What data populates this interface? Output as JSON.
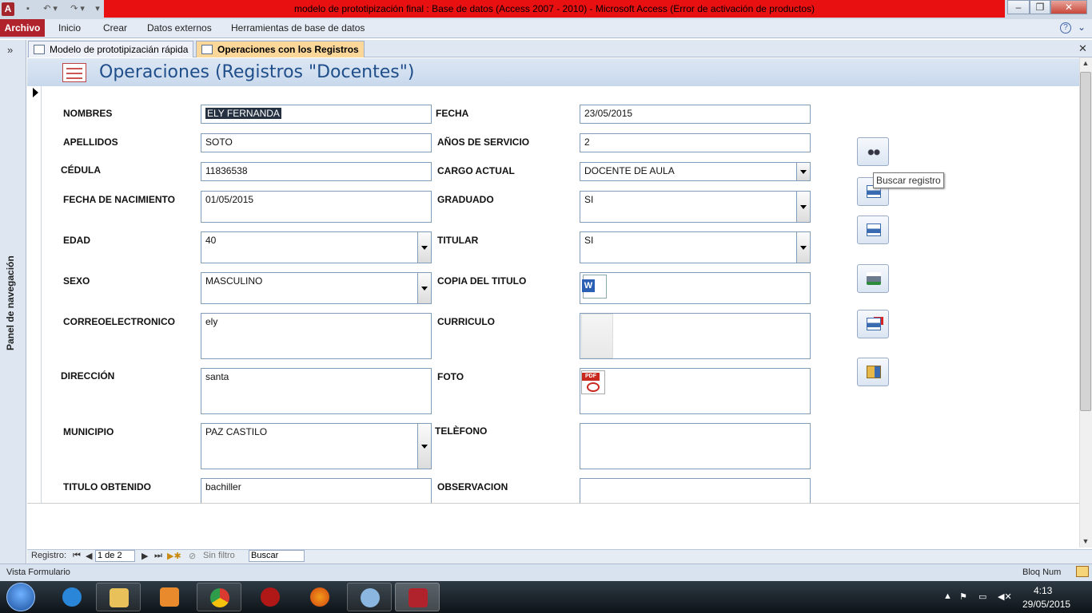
{
  "window": {
    "title": "modelo de prototipización final : Base de datos (Access 2007 - 2010)  -  Microsoft Access (Error de activación de productos)",
    "app_icon": "A"
  },
  "ribbon": {
    "file_tab": "Archivo",
    "tabs": [
      "Inicio",
      "Crear",
      "Datos externos",
      "Herramientas de base de datos"
    ]
  },
  "nav_pane": {
    "label": "Panel de navegación"
  },
  "doc_tabs": [
    {
      "label": "Modelo de prototipizacián rápida",
      "active": false
    },
    {
      "label": "Operaciones con los Registros",
      "active": true
    }
  ],
  "form": {
    "title": "Operaciones  (Registros \"Docentes\")",
    "left_fields": [
      {
        "label": "NOMBRES",
        "value": "ELY FERNANDA"
      },
      {
        "label": "APELLIDOS",
        "value": "SOTO"
      },
      {
        "label": "CÉDULA",
        "value": "11836538"
      },
      {
        "label": "FECHA DE NACIMIENTO",
        "value": "01/05/2015"
      },
      {
        "label": "EDAD",
        "value": "40"
      },
      {
        "label": "SEXO",
        "value": "MASCULINO"
      },
      {
        "label": "CORREOELECTRONICO",
        "value": "ely"
      },
      {
        "label": "DIRECCIÓN",
        "value": "santa"
      },
      {
        "label": "MUNICIPIO",
        "value": "PAZ CASTILO"
      },
      {
        "label": "TITULO OBTENIDO",
        "value": "bachiller"
      }
    ],
    "right_fields": [
      {
        "label": "FECHA",
        "value": "23/05/2015"
      },
      {
        "label": "AÑOS DE SERVICIO",
        "value": "2"
      },
      {
        "label": "CARGO ACTUAL",
        "value": "DOCENTE DE AULA"
      },
      {
        "label": "GRADUADO",
        "value": "SI"
      },
      {
        "label": "TITULAR",
        "value": "SI"
      },
      {
        "label": "COPIA DEL TITULO",
        "value": ""
      },
      {
        "label": "CURRICULO",
        "value": ""
      },
      {
        "label": "FOTO",
        "value": ""
      },
      {
        "label": "TELÈFONO",
        "value": ""
      },
      {
        "label": "OBSERVACION",
        "value": ""
      }
    ],
    "pdf_badge": "PDF",
    "word_badge": "W",
    "tooltip": "Buscar registro"
  },
  "record_nav": {
    "label": "Registro:",
    "current": "1 de 2",
    "filter": "Sin filtro",
    "search": "Buscar"
  },
  "status_bar": {
    "left": "Vista Formulario",
    "right": "Bloq Num"
  },
  "taskbar": {
    "time": "4:13",
    "date": "29/05/2015"
  }
}
